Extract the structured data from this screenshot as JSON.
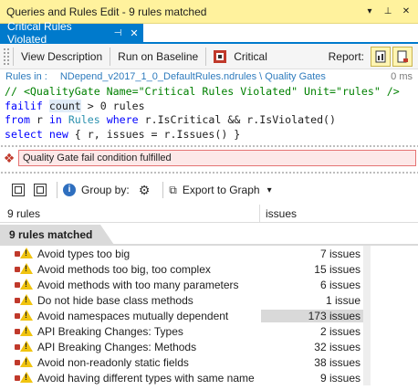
{
  "window": {
    "title": "Queries and Rules Edit  -  9 rules matched",
    "dropdown_icon": "chevron-down-icon",
    "pin_icon": "pin-icon",
    "close_icon": "close-icon"
  },
  "tab": {
    "label": "Critical Rules Violated",
    "pin_icon": "pin-icon",
    "close_icon": "close-icon"
  },
  "toolbar": {
    "view_description": "View Description",
    "run_on_baseline": "Run on Baseline",
    "critical": "Critical",
    "report": "Report:"
  },
  "rules_in": {
    "label": "Rules in :",
    "path": "NDepend_v2017_1_0_DefaultRules.ndrules \\ Quality Gates",
    "elapsed": "0 ms"
  },
  "code": {
    "line1_comment": "// <QualityGate Name=\"Critical Rules Violated\" Unit=\"rules\" />",
    "line2_kw": "failif",
    "line2_count": "count",
    "line2_rest": " > 0 rules",
    "line3_from": "from",
    "line3_r1": " r ",
    "line3_in": "in",
    "line3_rules": " Rules ",
    "line3_where": "where",
    "line3_rest": " r.IsCritical && r.IsViolated()",
    "line4_select": "select",
    "line4_new": " new",
    "line4_rest": " { r, issues = r.Issues() }"
  },
  "error": {
    "icon": "error-icon",
    "message": "Quality Gate fail condition fulfilled"
  },
  "results_toolbar": {
    "group_by": "Group by:",
    "export": "Export to Graph",
    "export_dropdown": "▾"
  },
  "results": {
    "header_col1": "9 rules",
    "header_col2": "issues",
    "group_label": "9 rules matched",
    "rows": [
      {
        "name": "Avoid types too big",
        "issues": "7 issues"
      },
      {
        "name": "Avoid methods too big, too complex",
        "issues": "15 issues"
      },
      {
        "name": "Avoid methods with too many parameters",
        "issues": "6 issues"
      },
      {
        "name": "Do not hide base class methods",
        "issues": "1 issue"
      },
      {
        "name": "Avoid namespaces mutually dependent",
        "issues": "173 issues"
      },
      {
        "name": "API Breaking Changes: Types",
        "issues": "2 issues"
      },
      {
        "name": "API Breaking Changes: Methods",
        "issues": "32 issues"
      },
      {
        "name": "Avoid non-readonly static fields",
        "issues": "38 issues"
      },
      {
        "name": "Avoid having different types with same name",
        "issues": "9 issues"
      }
    ]
  },
  "colors": {
    "title_bar": "#fff29d",
    "tab_active": "#007acc",
    "error_bg": "#fde8e8",
    "warning": "#f1c40f"
  }
}
